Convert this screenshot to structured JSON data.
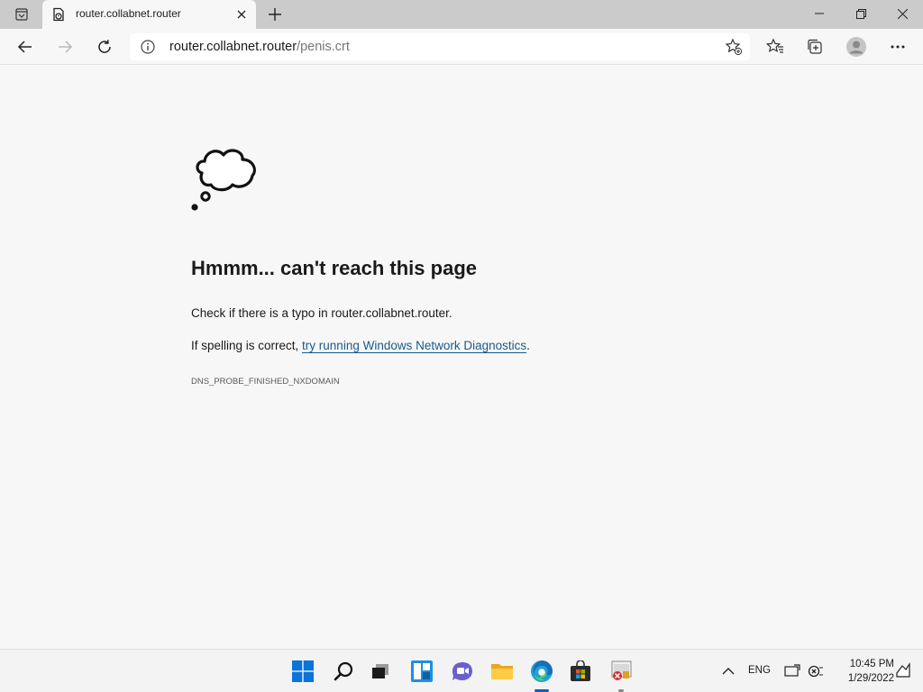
{
  "browser": {
    "tab": {
      "title": "router.collabnet.router"
    },
    "address": {
      "host": "router.collabnet.router",
      "path": "/penis.crt"
    }
  },
  "page": {
    "headline": "Hmmm... can't reach this page",
    "line1_prefix": "Check if there is a typo in ",
    "line1_host": "router.collabnet.router",
    "line1_suffix": ".",
    "line2_prefix": "If spelling is correct, ",
    "line2_link": "try running Windows Network Diagnostics",
    "line2_suffix": ".",
    "error_code": "DNS_PROBE_FINISHED_NXDOMAIN"
  },
  "taskbar": {
    "language": "ENG",
    "time": "10:45 PM",
    "date": "1/29/2022"
  },
  "colors": {
    "accent": "#0067c0",
    "link": "#1a5a8a",
    "tabstrip": "#cbcbcb",
    "page_bg": "#f7f7f7"
  },
  "icons": [
    "tab-actions-icon",
    "page-favicon-icon",
    "close-tab-icon",
    "new-tab-icon",
    "minimize-icon",
    "maximize-icon",
    "close-window-icon",
    "back-icon",
    "forward-icon",
    "refresh-icon",
    "info-icon",
    "add-favorite-icon",
    "favorites-icon",
    "collections-icon",
    "profile-icon",
    "more-icon",
    "thought-cloud-icon",
    "start-icon",
    "search-icon",
    "task-view-icon",
    "widgets-icon",
    "chat-icon",
    "file-explorer-icon",
    "edge-icon",
    "store-icon",
    "app-icon",
    "chevron-up-icon",
    "display-icon",
    "network-icon",
    "notifications-icon"
  ]
}
